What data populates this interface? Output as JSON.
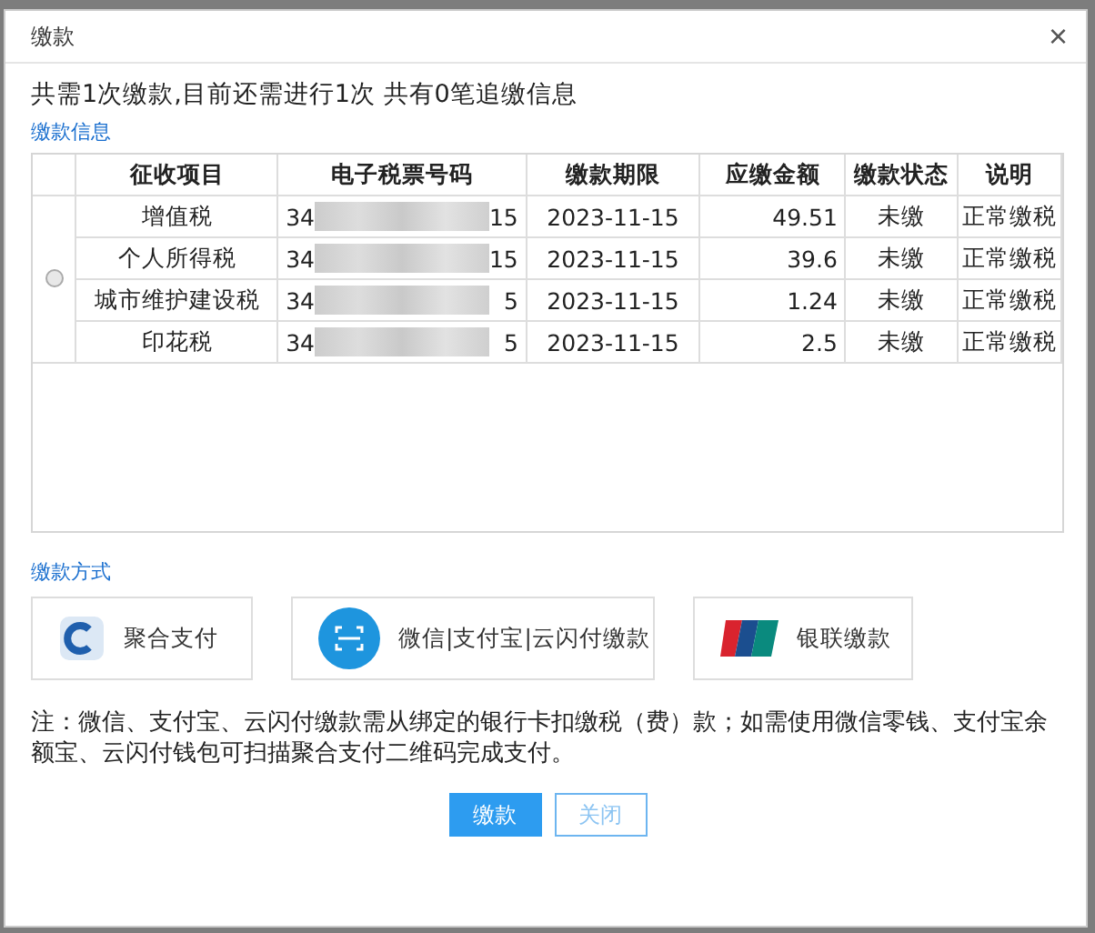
{
  "dialog": {
    "title": "缴款",
    "close": "×"
  },
  "summary": "共需1次缴款,目前还需进行1次 共有0笔追缴信息",
  "info_label": "缴款信息",
  "table": {
    "radio_selected": false,
    "columns": [
      "征收项目",
      "电子税票号码",
      "缴款期限",
      "应缴金额",
      "缴款状态",
      "说明"
    ],
    "rows": [
      {
        "item": "增值税",
        "ticket_start": "34",
        "ticket_end": "15",
        "deadline": "2023-11-15",
        "amount": "49.51",
        "status": "未缴",
        "note": "正常缴税"
      },
      {
        "item": "个人所得税",
        "ticket_start": "34",
        "ticket_end": "15",
        "deadline": "2023-11-15",
        "amount": "39.6",
        "status": "未缴",
        "note": "正常缴税"
      },
      {
        "item": "城市维护建设税",
        "ticket_start": "34",
        "ticket_end": "5",
        "deadline": "2023-11-15",
        "amount": "1.24",
        "status": "未缴",
        "note": "正常缴税"
      },
      {
        "item": "印花税",
        "ticket_start": "34",
        "ticket_end": "5",
        "deadline": "2023-11-15",
        "amount": "2.5",
        "status": "未缴",
        "note": "正常缴税"
      }
    ]
  },
  "method_label": "缴款方式",
  "methods": [
    {
      "kind": "aggregate",
      "label": "聚合支付"
    },
    {
      "kind": "scan",
      "label": "微信|支付宝|云闪付缴款"
    },
    {
      "kind": "unionpay",
      "label": "银联缴款"
    }
  ],
  "note": "注：微信、支付宝、云闪付缴款需从绑定的银行卡扣缴税（费）款；如需使用微信零钱、支付宝余额宝、云闪付钱包可扫描聚合支付二维码完成支付。",
  "buttons": [
    {
      "kind": "primary",
      "label": "缴款"
    },
    {
      "kind": "secondary",
      "label": "关闭"
    }
  ]
}
